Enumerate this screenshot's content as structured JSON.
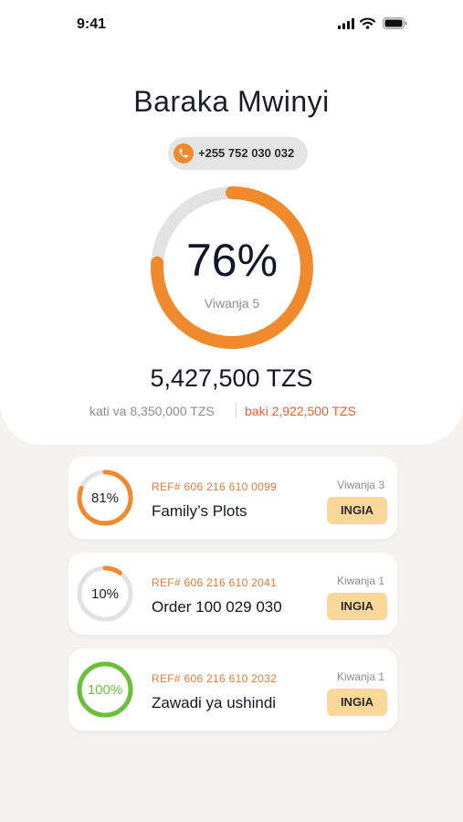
{
  "status_bar": {
    "time": "9:41"
  },
  "profile": {
    "name": "Baraka Mwinyi",
    "phone": "+255 752 030 032"
  },
  "summary": {
    "progress_percent_label": "76%",
    "progress_fraction": 0.76,
    "plots_label": "Viwanja 5",
    "amount_paid": "5,427,500 TZS",
    "amount_total": "kati va 8,350,000 TZS",
    "amount_remaining": "baki 2,922,500 TZS"
  },
  "colors": {
    "accent": "#f08a2c",
    "ring_track": "#e2e2e2",
    "complete": "#6cbf3a",
    "button_bg": "#fcd79a",
    "ref_text": "#e07a3a",
    "balance_text": "#e0603a"
  },
  "plots": [
    {
      "percent_label": "81%",
      "progress_fraction": 0.81,
      "ref": "REF# 606 216 610 0099",
      "name": "Family’s Plots",
      "count": "Viwanja 3",
      "action": "INGIA",
      "complete": false
    },
    {
      "percent_label": "10%",
      "progress_fraction": 0.1,
      "ref": "REF# 606 216 610 2041",
      "name": "Order 100 029 030",
      "count": "Kiwanja 1",
      "action": "INGIA",
      "complete": false
    },
    {
      "percent_label": "100%",
      "progress_fraction": 1.0,
      "ref": "REF# 606 216 610 2032",
      "name": "Zawadi ya ushindi",
      "count": "Kiwanja 1",
      "action": "INGIA",
      "complete": true
    }
  ]
}
